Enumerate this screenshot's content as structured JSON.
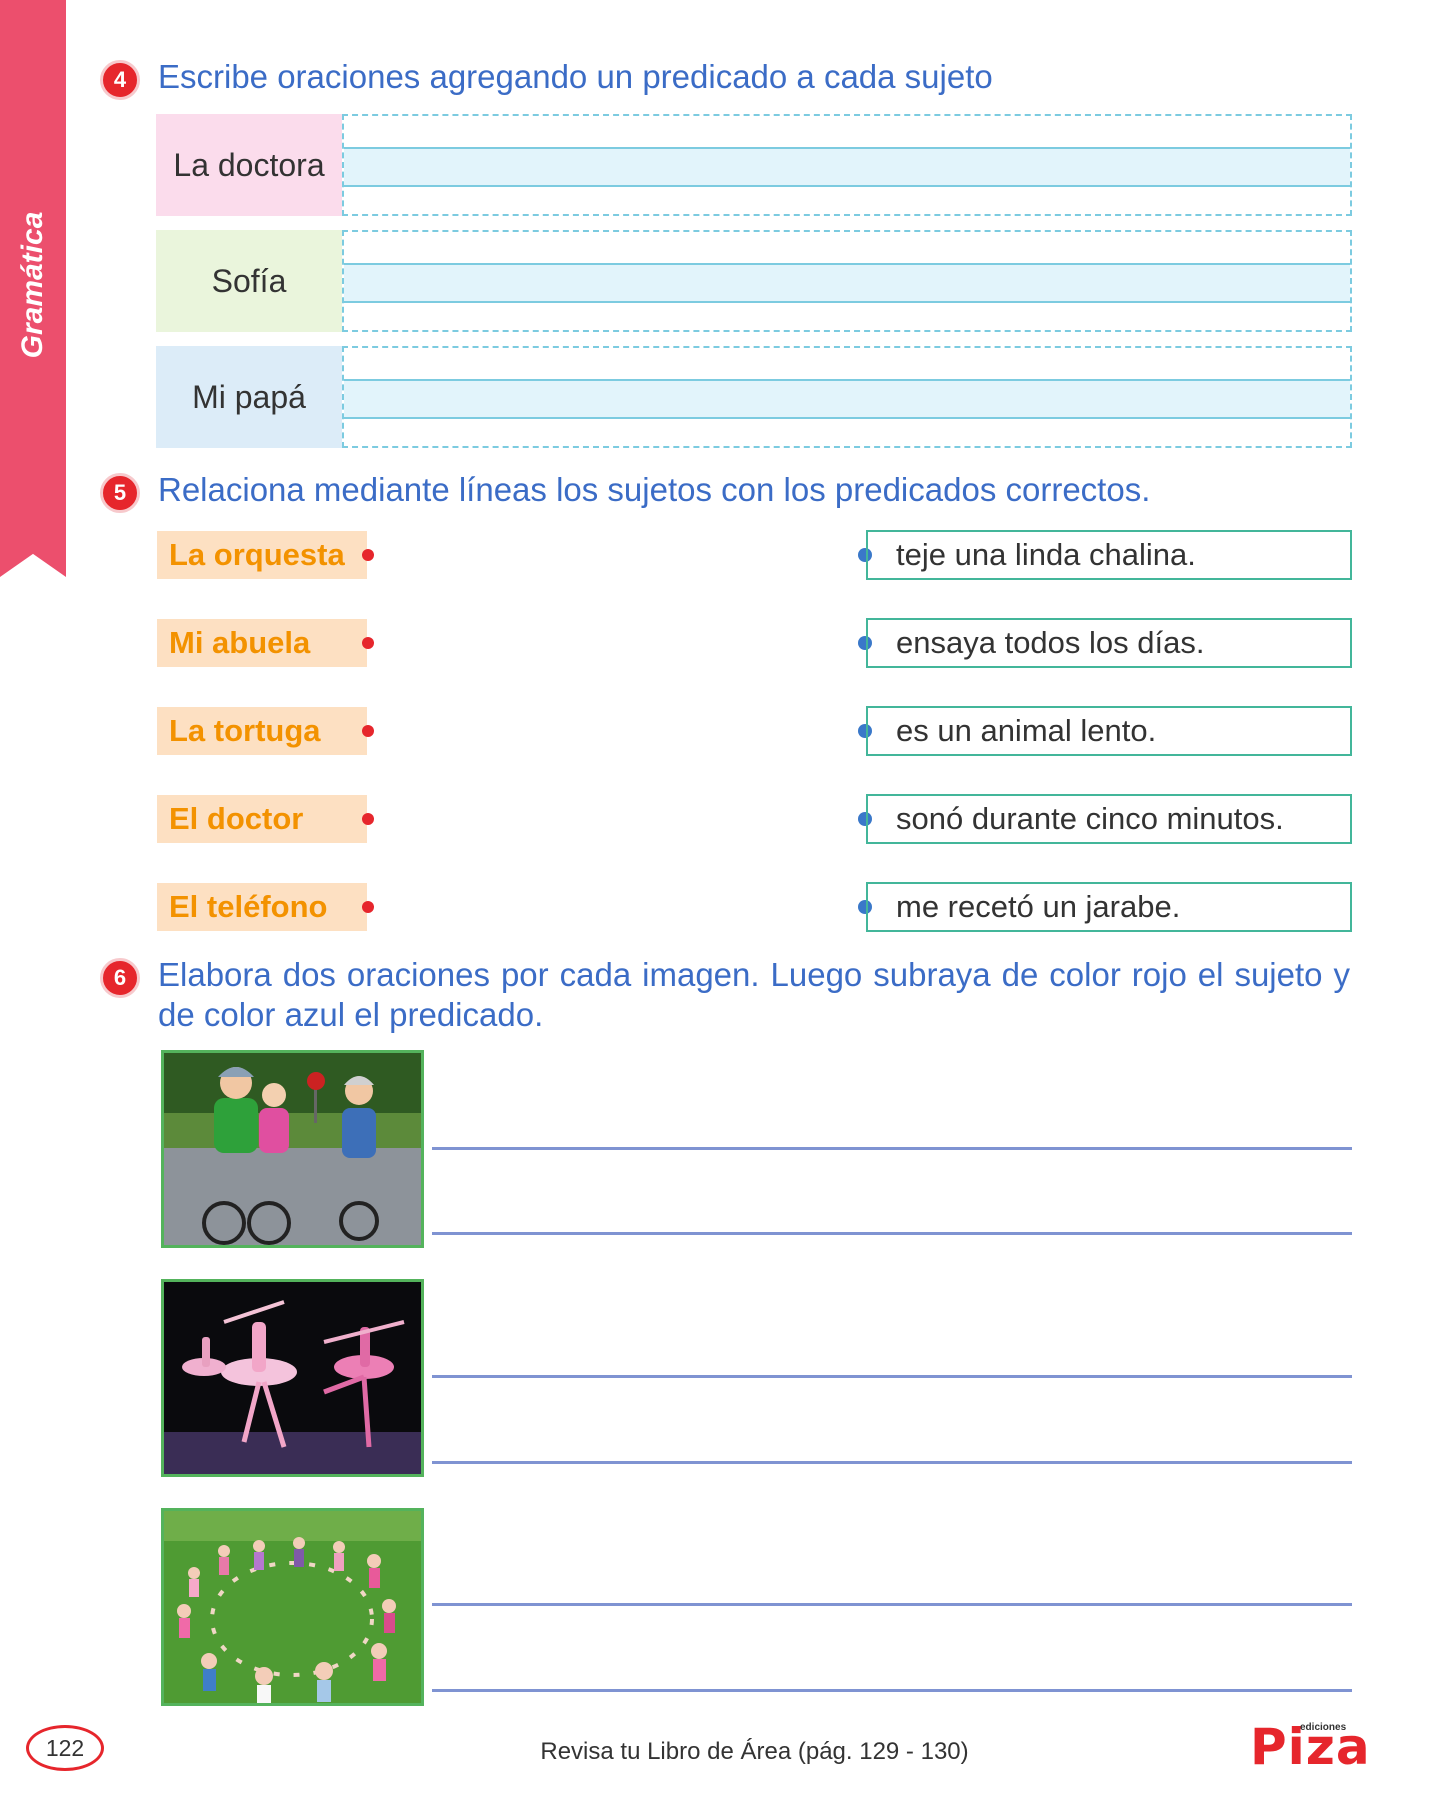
{
  "side_tab": {
    "label": "Gramática"
  },
  "section4": {
    "number": "4",
    "title": "Escribe oraciones agregando un predicado a cada sujeto",
    "rows": [
      {
        "label": "La doctora",
        "bg": "#fbdcec"
      },
      {
        "label": "Sofía",
        "bg": "#eaf5dc"
      },
      {
        "label": "Mi papá",
        "bg": "#dcecf8"
      }
    ]
  },
  "section5": {
    "number": "5",
    "title": "Relaciona mediante líneas los sujetos con los predicados correctos.",
    "subjects": [
      "La orquesta",
      "Mi abuela",
      "La tortuga",
      "El doctor",
      "El teléfono"
    ],
    "predicates": [
      "teje una linda chalina.",
      "ensaya todos los días.",
      "es un animal lento.",
      "sonó durante cinco minutos.",
      "me recetó un jarabe."
    ]
  },
  "section6": {
    "number": "6",
    "title": "Elabora dos oraciones por cada imagen. Luego subraya de color rojo el sujeto y de color azul el predicado.",
    "images": [
      "children-biking-photo",
      "ballet-dancers-photo",
      "children-circle-photo"
    ]
  },
  "footer": {
    "page_number": "122",
    "reference": "Revisa tu Libro de Área (pág. 129 - 130)",
    "publisher_small": "ediciones",
    "publisher": "Piza"
  },
  "colors": {
    "accent_red": "#e6262c",
    "title_blue": "#3b6cc6",
    "subject_orange": "#f39200",
    "tab_pink": "#ec4f6d"
  }
}
